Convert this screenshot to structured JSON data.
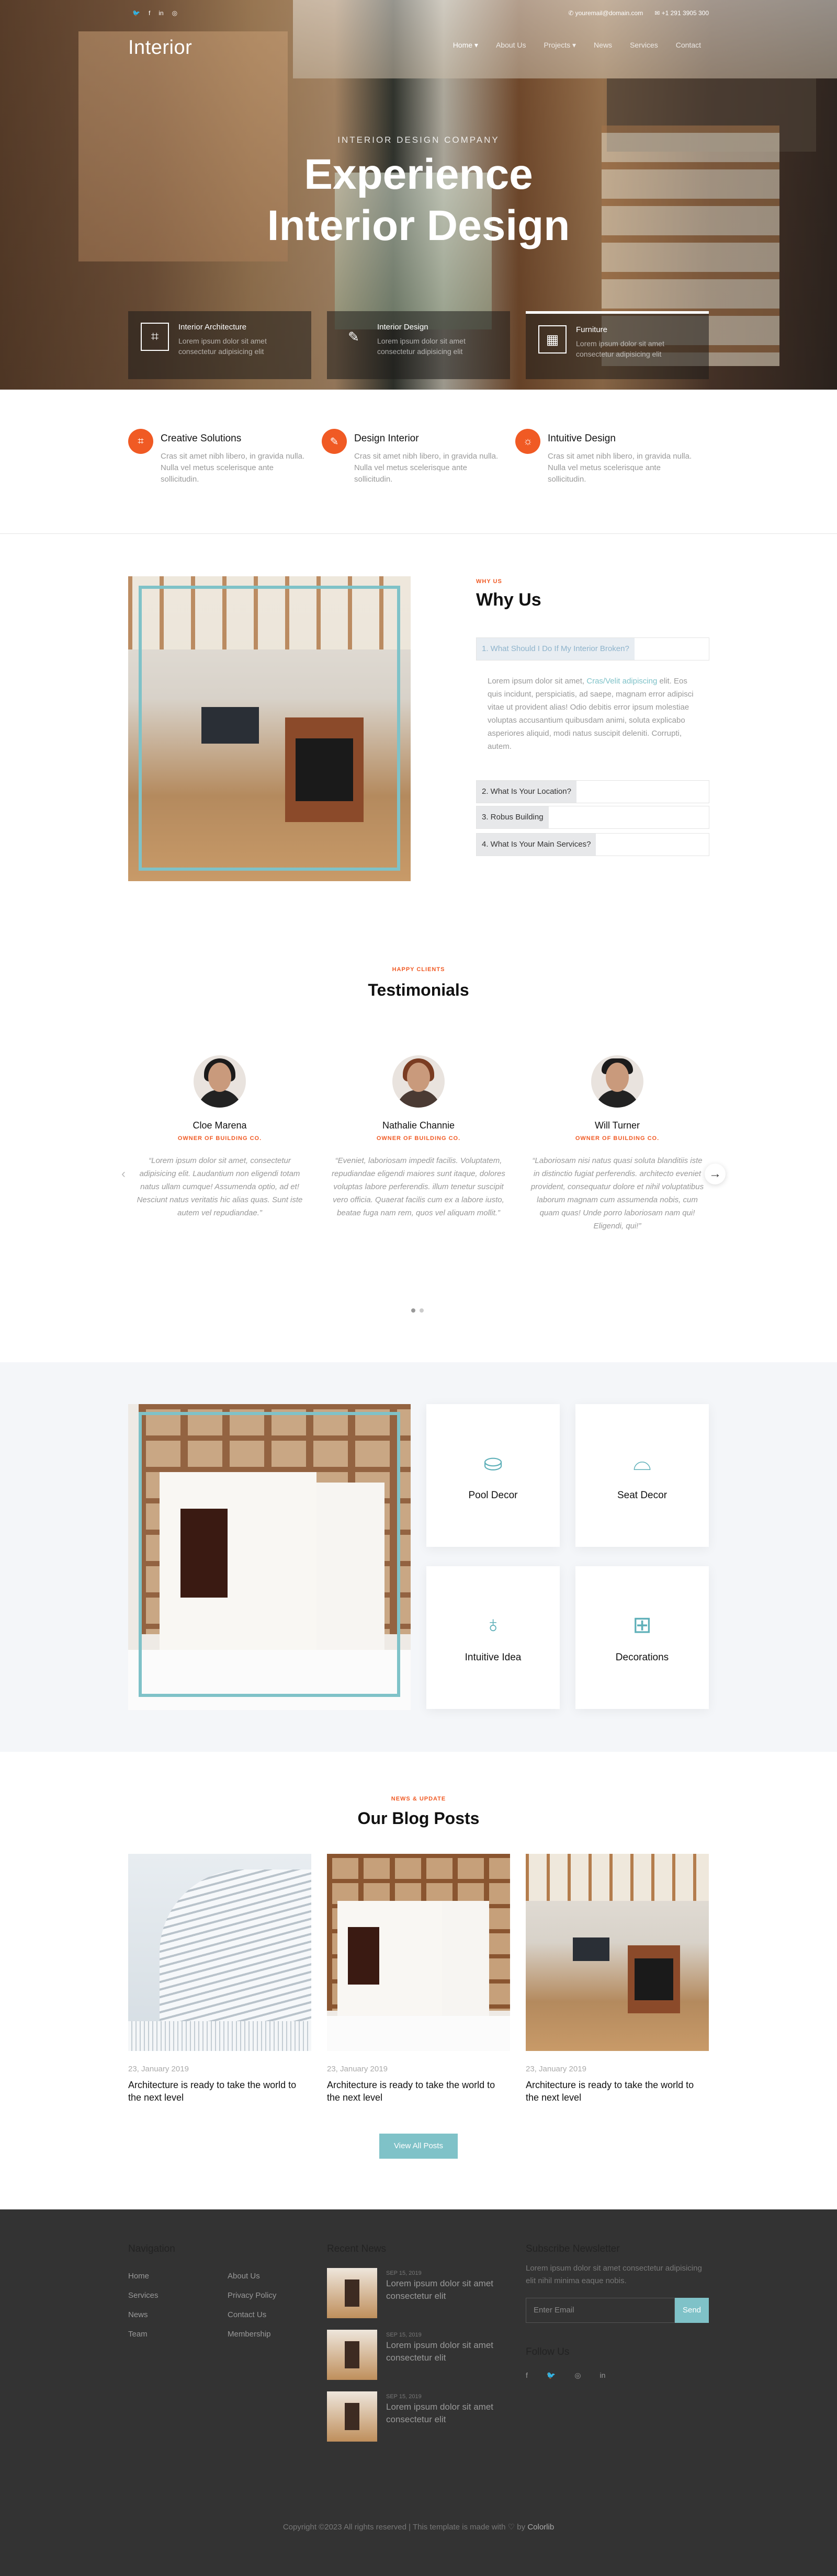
{
  "topbar": {
    "social": [
      "twitter-icon",
      "facebook-icon",
      "linkedin-icon",
      "instagram-icon"
    ],
    "email": "youremail@domain.com",
    "phone": "+1 291 3905 300"
  },
  "nav": {
    "logo": "Interior",
    "items": [
      "Home ▾",
      "About Us",
      "Projects ▾",
      "News",
      "Services",
      "Contact"
    ]
  },
  "hero": {
    "subtitle": "INTERIOR DESIGN COMPANY",
    "title_line1": "Experience",
    "title_line2": "Interior Design",
    "cards": [
      {
        "title": "Interior Architecture",
        "desc": "Lorem ipsum dolor sit amet consectetur adipisicing elit"
      },
      {
        "title": "Interior Design",
        "desc": "Lorem ipsum dolor sit amet consectetur adipisicing elit"
      },
      {
        "title": "Furniture",
        "desc": "Lorem ipsum dolor sit amet consectetur adipisicing elit"
      }
    ]
  },
  "services": [
    {
      "title": "Creative Solutions",
      "desc": "Cras sit amet nibh libero, in gravida nulla. Nulla vel metus scelerisque ante sollicitudin."
    },
    {
      "title": "Design Interior",
      "desc": "Cras sit amet nibh libero, in gravida nulla. Nulla vel metus scelerisque ante sollicitudin."
    },
    {
      "title": "Intuitive Design",
      "desc": "Cras sit amet nibh libero, in gravida nulla. Nulla vel metus scelerisque ante sollicitudin."
    }
  ],
  "why": {
    "eyebrow": "WHY US",
    "title": "Why Us",
    "accordion": [
      "1. What Should I Do If My Interior Broken?",
      "2. What Is Your Location?",
      "3. Robus Building",
      "4. What Is Your Main Services?"
    ],
    "body_pre": "Lorem ipsum dolor sit amet, ",
    "body_link": "Cras/Velit adipiscing",
    "body_post": " elit. Eos quis incidunt, perspiciatis, ad saepe, magnam error adipisci vitae ut provident alias! Odio debitis error ipsum molestiae voluptas accusantium quibusdam animi, soluta explicabo asperiores aliquid, modi natus suscipit deleniti. Corrupti, autem."
  },
  "testimonials": {
    "eyebrow": "HAPPY CLIENTS",
    "title": "Testimonials",
    "items": [
      {
        "name": "Cloe Marena",
        "role": "OWNER OF BUILDING CO.",
        "quote": "“Lorem ipsum dolor sit amet, consectetur adipisicing elit. Laudantium non eligendi totam natus ullam cumque! Assumenda optio, ad et! Nesciunt natus veritatis hic alias quas. Sunt iste autem vel repudiandae.”"
      },
      {
        "name": "Nathalie Channie",
        "role": "OWNER OF BUILDING CO.",
        "quote": "“Eveniet, laboriosam impedit facilis. Voluptatem, repudiandae eligendi maiores sunt itaque, dolores voluptas labore perferendis. illum tenetur suscipit vero officia. Quaerat facilis cum ex a labore iusto, beatae fuga nam rem, quos vel aliquam mollit.”"
      },
      {
        "name": "Will Turner",
        "role": "OWNER OF BUILDING CO.",
        "quote": "“Laboriosam nisi natus quasi soluta blanditiis iste in distinctio fugiat perferendis. architecto eveniet provident, consequatur dolore et nihil voluptatibus laborum magnam cum assumenda nobis, cum quam quas! Unde porro laboriosam nam qui! Eligendi, qui!”"
      }
    ]
  },
  "features": [
    {
      "title": "Pool Decor",
      "icon": "pool-icon"
    },
    {
      "title": "Seat Decor",
      "icon": "sofa-icon"
    },
    {
      "title": "Intuitive Idea",
      "icon": "lightbulb-icon"
    },
    {
      "title": "Decorations",
      "icon": "window-icon"
    }
  ],
  "blog": {
    "eyebrow": "NEWS & UPDATE",
    "title": "Our Blog Posts",
    "posts": [
      {
        "date": "23, January 2019",
        "title": "Architecture is ready to take the world to the next level"
      },
      {
        "date": "23, January 2019",
        "title": "Architecture is ready to take the world to the next level"
      },
      {
        "date": "23, January 2019",
        "title": "Architecture is ready to take the world to the next level"
      }
    ],
    "button": "View All Posts"
  },
  "footer": {
    "nav_title": "Navigation",
    "nav_col1": [
      "Home",
      "Services",
      "News",
      "Team"
    ],
    "nav_col2": [
      "About Us",
      "Privacy Policy",
      "Contact Us",
      "Membership"
    ],
    "news_title": "Recent News",
    "news": [
      {
        "date": "SEP 15, 2019",
        "title": "Lorem ipsum dolor sit amet consectetur elit"
      },
      {
        "date": "SEP 15, 2019",
        "title": "Lorem ipsum dolor sit amet consectetur elit"
      },
      {
        "date": "SEP 15, 2019",
        "title": "Lorem ipsum dolor sit amet consectetur elit"
      }
    ],
    "subscribe_title": "Subscribe Newsletter",
    "subscribe_text": "Lorem ipsum dolor sit amet consectetur adipisicing elit nihil minima eaque nobis.",
    "email_placeholder": "Enter Email",
    "send": "Send",
    "follow_title": "Follow Us",
    "follow_icons": [
      "facebook-icon",
      "twitter-icon",
      "instagram-icon",
      "linkedin-icon"
    ],
    "copyright": "Copyright ©2023 All rights reserved | This template is made with ♡ by ",
    "brand": "Colorlib"
  },
  "colors": {
    "accent": "#f05a24",
    "teal": "#7fc2c8",
    "footer": "#333333"
  }
}
